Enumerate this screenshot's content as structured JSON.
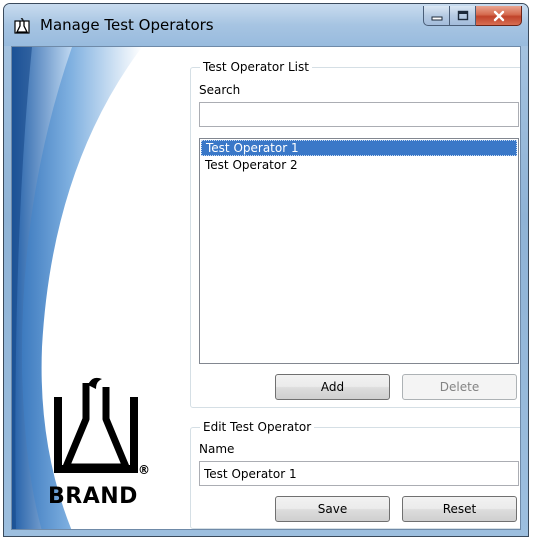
{
  "window": {
    "title": "Manage Test Operators",
    "icon": "brand-flask-icon"
  },
  "list_group": {
    "legend": "Test Operator List",
    "search_label": "Search",
    "search_value": "",
    "items": [
      {
        "label": "Test Operator 1",
        "selected": true
      },
      {
        "label": "Test Operator 2",
        "selected": false
      }
    ],
    "add_label": "Add",
    "delete_label": "Delete"
  },
  "edit_group": {
    "legend": "Edit Test Operator",
    "name_label": "Name",
    "name_value": "Test Operator 1",
    "save_label": "Save",
    "reset_label": "Reset"
  },
  "branding": {
    "logo_text": "BRAND",
    "registered_mark": "®"
  },
  "colors": {
    "selection": "#3a78c8",
    "close_button": "#c0432a",
    "title_bar": "#a6c4e2"
  }
}
